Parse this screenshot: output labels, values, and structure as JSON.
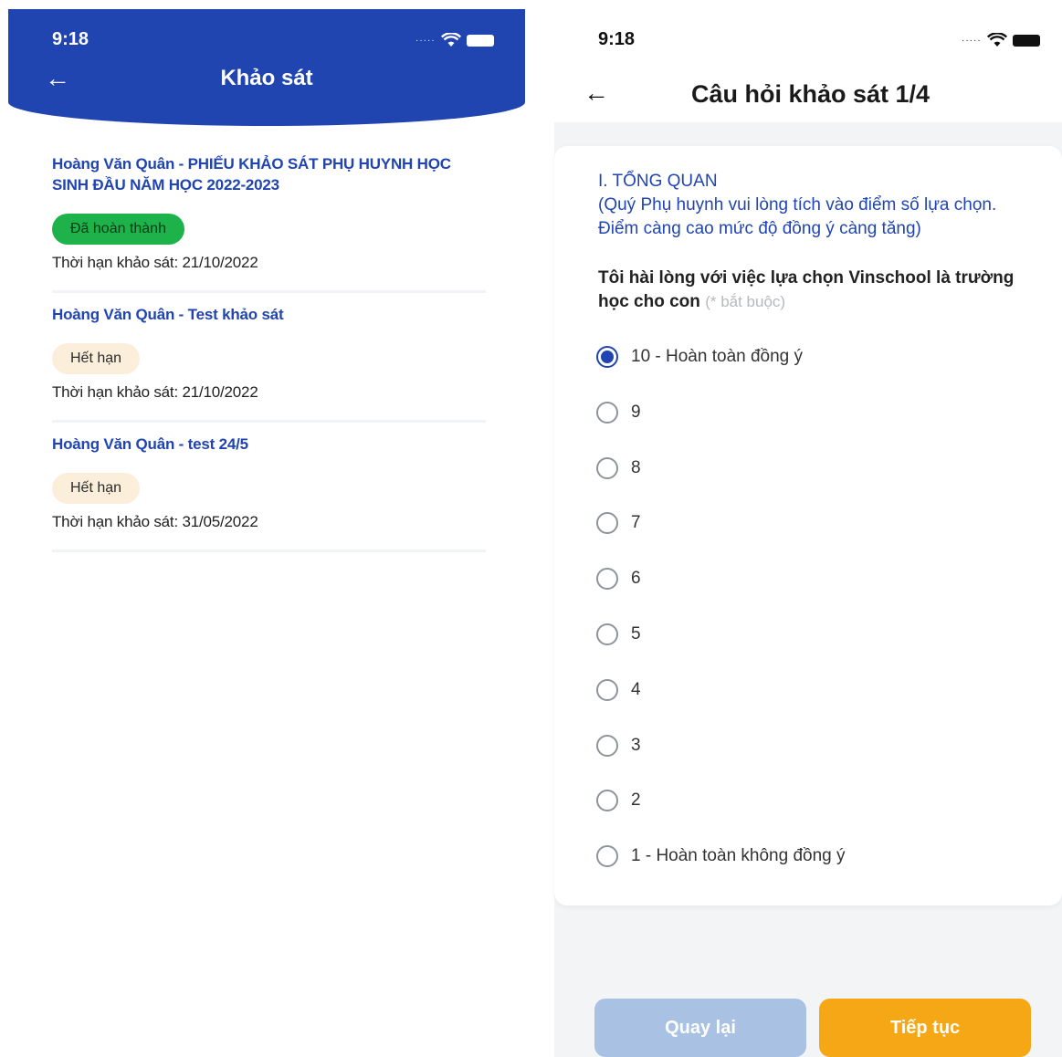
{
  "left": {
    "status_time": "9:18",
    "title": "Khảo sát",
    "surveys": [
      {
        "title": "Hoàng Văn Quân - PHIẾU KHẢO SÁT PHỤ HUYNH HỌC SINH ĐẦU NĂM HỌC 2022-2023",
        "status": "Đã hoàn thành",
        "deadline": "Thời hạn khảo sát: 21/10/2022"
      },
      {
        "title": "Hoàng Văn Quân - Test khảo sát",
        "status": "Hết hạn",
        "deadline": "Thời hạn khảo sát: 21/10/2022"
      },
      {
        "title": "Hoàng Văn Quân - test 24/5",
        "status": "Hết hạn",
        "deadline": "Thời hạn khảo sát: 31/05/2022"
      }
    ]
  },
  "right": {
    "status_time": "9:18",
    "title": "Câu hỏi khảo sát 1/4",
    "section_title": "I. TỔNG QUAN",
    "section_note": "(Quý Phụ huynh vui lòng tích vào điểm số lựa chọn. Điểm càng cao mức độ đồng ý càng tăng)",
    "question": "Tôi hài lòng với việc lựa chọn Vinschool là trường học cho con",
    "required_note": "(* bắt buộc)",
    "options": [
      "10 - Hoàn toàn đồng ý",
      "9",
      "8",
      "7",
      "6",
      "5",
      "4",
      "3",
      "2",
      "1 - Hoàn toàn không đồng ý"
    ],
    "selected_option": "10 - Hoàn toàn đồng ý",
    "back_button": "Quay lại",
    "next_button": "Tiếp tục"
  },
  "colors": {
    "brand_blue": "#2145b0",
    "done_green": "#1db34a",
    "expired_bg": "#fbefdc",
    "next_orange": "#f5a716",
    "back_disabled": "#a9c2e3"
  },
  "icons": [
    "back-arrow-icon",
    "wifi-icon",
    "battery-icon",
    "signal-dots-icon",
    "radio-icon"
  ]
}
